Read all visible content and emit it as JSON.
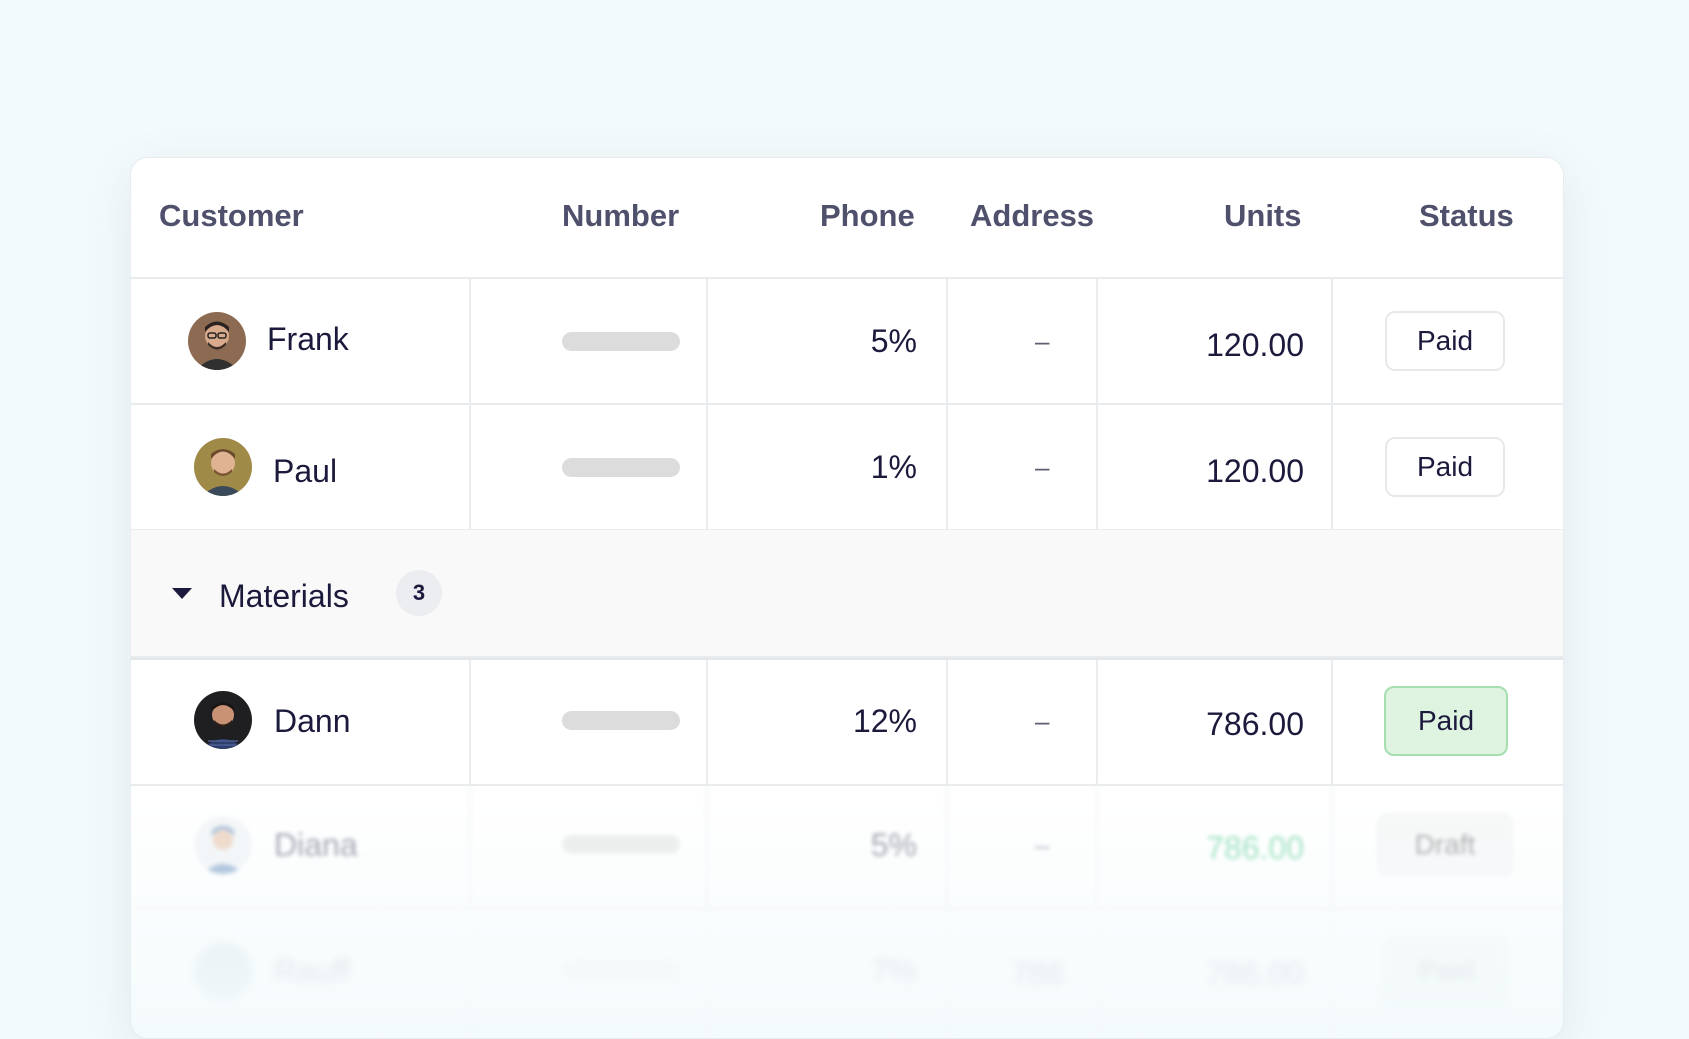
{
  "table": {
    "columns": {
      "customer": "Customer",
      "number": "Number",
      "phone": "Phone",
      "address": "Address",
      "units": "Units",
      "status": "Status"
    },
    "rows_top": [
      {
        "name": "Frank",
        "pct": "5%",
        "address": "–",
        "units": "120.00",
        "status": "Paid"
      },
      {
        "name": "Paul",
        "pct": "1%",
        "address": "–",
        "units": "120.00",
        "status": "Paid"
      }
    ],
    "group": {
      "label": "Materials",
      "count": "3"
    },
    "rows_group": [
      {
        "name": "Dann",
        "pct": "12%",
        "address": "–",
        "units": "786.00",
        "status": "Paid"
      },
      {
        "name": "Diana",
        "pct": "5%",
        "address": "–",
        "units": "786.00",
        "status": "Draft"
      },
      {
        "name": "Rauff",
        "pct": "7%",
        "address": "786",
        "units": "786.00",
        "status": "Paid"
      }
    ]
  },
  "colors": {
    "background": "#f3fafc",
    "header_text": "#4f506c",
    "body_text": "#1b1a3c",
    "paid_green_bg": "#dff3e1",
    "paid_green_border": "#a6deb0",
    "units_green": "#34c27a"
  }
}
